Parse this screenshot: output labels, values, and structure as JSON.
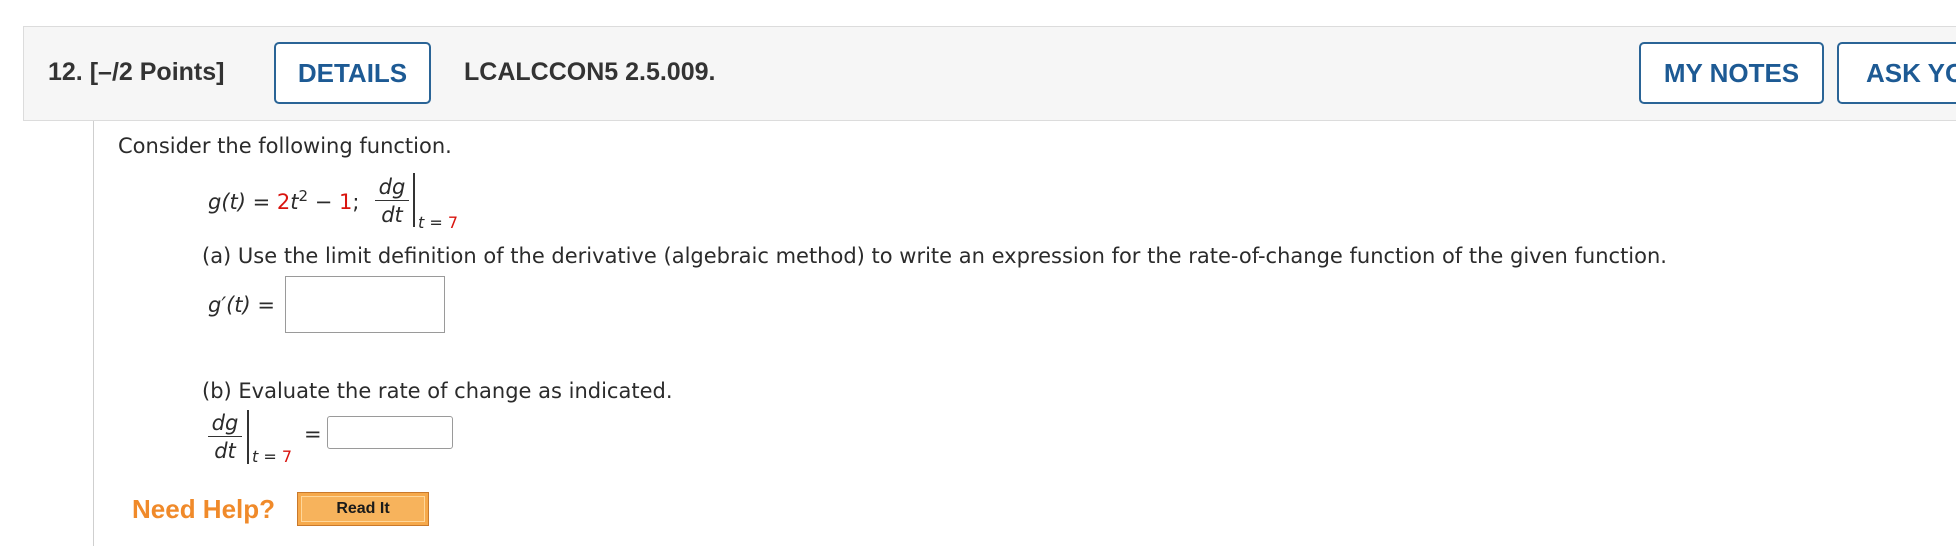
{
  "question": {
    "number_label": "12.",
    "points_label": "[–/2 Points]",
    "details_button": "DETAILS",
    "assignment_id": "LCALCCON5 2.5.009.",
    "my_notes_button": "MY NOTES",
    "ask_button": "ASK YO"
  },
  "body": {
    "intro": "Consider the following function.",
    "function": {
      "lhs": "g(t) =",
      "coef": "2",
      "var": "t",
      "exp": "2",
      "minus": " − ",
      "const": "1",
      "sep": ";",
      "frac_num": "dg",
      "frac_den": "dt",
      "eval_var": "t =",
      "eval_val": "7"
    },
    "part_a": {
      "prompt": "(a) Use the limit definition of the derivative (algebraic method) to write an expression for the rate-of-change function of the given function.",
      "lhs": "g′(t) =",
      "answer_value": ""
    },
    "part_b": {
      "prompt": "(b) Evaluate the rate of change as indicated.",
      "frac_num": "dg",
      "frac_den": "dt",
      "eval_var": "t =",
      "eval_val": "7",
      "equals": "=",
      "answer_value": ""
    }
  },
  "help": {
    "label": "Need Help?",
    "read_it_button": "Read It"
  }
}
